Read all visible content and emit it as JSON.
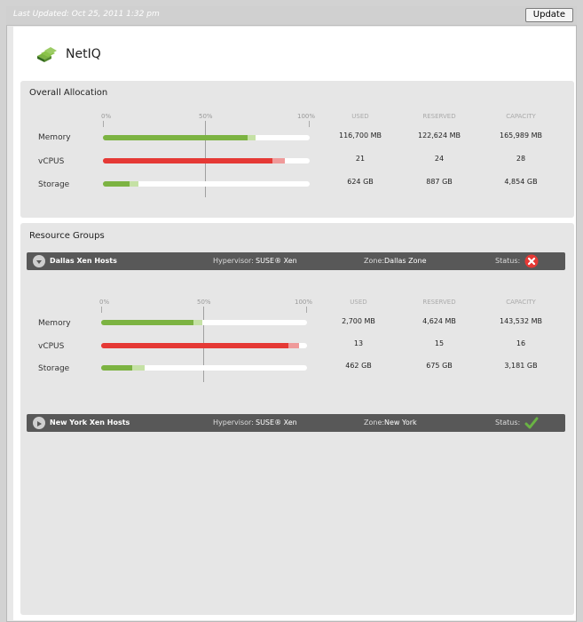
{
  "topbar": {
    "last_updated": "Last Updated: Oct 25, 2011 1:32 pm",
    "update_label": "Update"
  },
  "brand": {
    "name": "NetIQ"
  },
  "columns": {
    "used": "USED",
    "reserved": "RESERVED",
    "capacity": "CAPACITY"
  },
  "ticks": {
    "t0": "0%",
    "t50": "50%",
    "t100": "100%"
  },
  "overall": {
    "title": "Overall Allocation",
    "rows": [
      {
        "label": "Memory",
        "used": "116,700 MB",
        "reserved": "122,624 MB",
        "capacity": "165,989 MB",
        "used_pct": 0.7,
        "reserved_pct": 0.74,
        "color": "#7cb342",
        "light": "#c5e1a5"
      },
      {
        "label": "vCPUS",
        "used": "21",
        "reserved": "24",
        "capacity": "28",
        "used_pct": 0.82,
        "reserved_pct": 0.88,
        "color": "#e53935",
        "light": "#ef9a9a"
      },
      {
        "label": "Storage",
        "used": "624 GB",
        "reserved": "887 GB",
        "capacity": "4,854 GB",
        "used_pct": 0.13,
        "reserved_pct": 0.17,
        "color": "#7cb342",
        "light": "#c5e1a5"
      }
    ]
  },
  "groups": {
    "title": "Resource Groups",
    "hyp_label": "Hypervisor:",
    "zone_label": "Zone:",
    "status_label": "Status:",
    "items": [
      {
        "name": "Dallas Xen Hosts",
        "hypervisor": "SUSE® Xen",
        "zone": "Dallas Zone",
        "status": "error",
        "status_color": "#e53935"
      },
      {
        "name": "New York Xen Hosts",
        "hypervisor": "SUSE® Xen",
        "zone": "New York",
        "status": "ok",
        "status_color": "#6ab344"
      }
    ],
    "detail_rows": [
      {
        "label": "Memory",
        "used": "2,700 MB",
        "reserved": "4,624 MB",
        "capacity": "143,532 MB",
        "used_pct": 0.45,
        "reserved_pct": 0.49,
        "color": "#7cb342",
        "light": "#c5e1a5"
      },
      {
        "label": "vCPUS",
        "used": "13",
        "reserved": "15",
        "capacity": "16",
        "used_pct": 0.91,
        "reserved_pct": 0.96,
        "color": "#e53935",
        "light": "#ef9a9a"
      },
      {
        "label": "Storage",
        "used": "462 GB",
        "reserved": "675 GB",
        "capacity": "3,181 GB",
        "used_pct": 0.15,
        "reserved_pct": 0.21,
        "color": "#7cb342",
        "light": "#c5e1a5"
      }
    ]
  }
}
